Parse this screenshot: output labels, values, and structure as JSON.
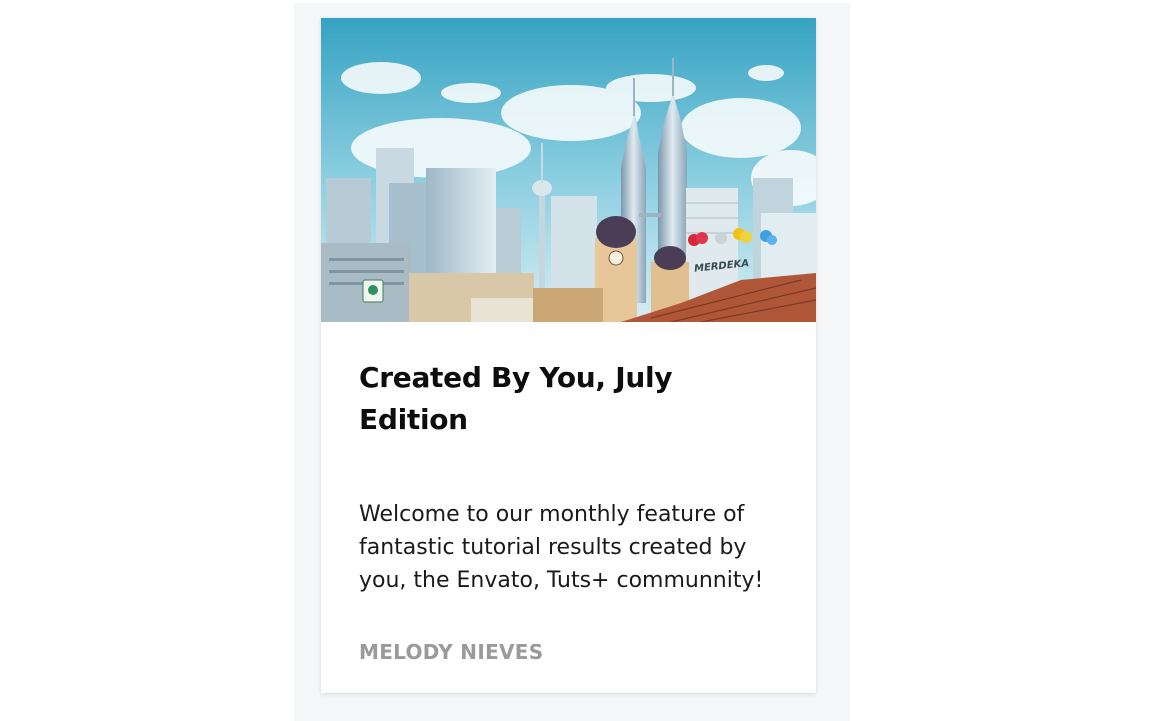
{
  "card": {
    "title": "Created By You, July Edition",
    "excerpt": "Welcome to our monthly feature of fantastic tutorial results created by you, the Envato, Tuts+ communnity!",
    "author": "MELODY NIEVES",
    "image_sign": "MERDEKA"
  },
  "colors": {
    "panel_bg": "#f5f6f8",
    "card_bg": "#ffffff",
    "author_text": "#9a9a9a",
    "sky_top": "#3aa6c4",
    "sky_bottom": "#cfe9f0"
  }
}
